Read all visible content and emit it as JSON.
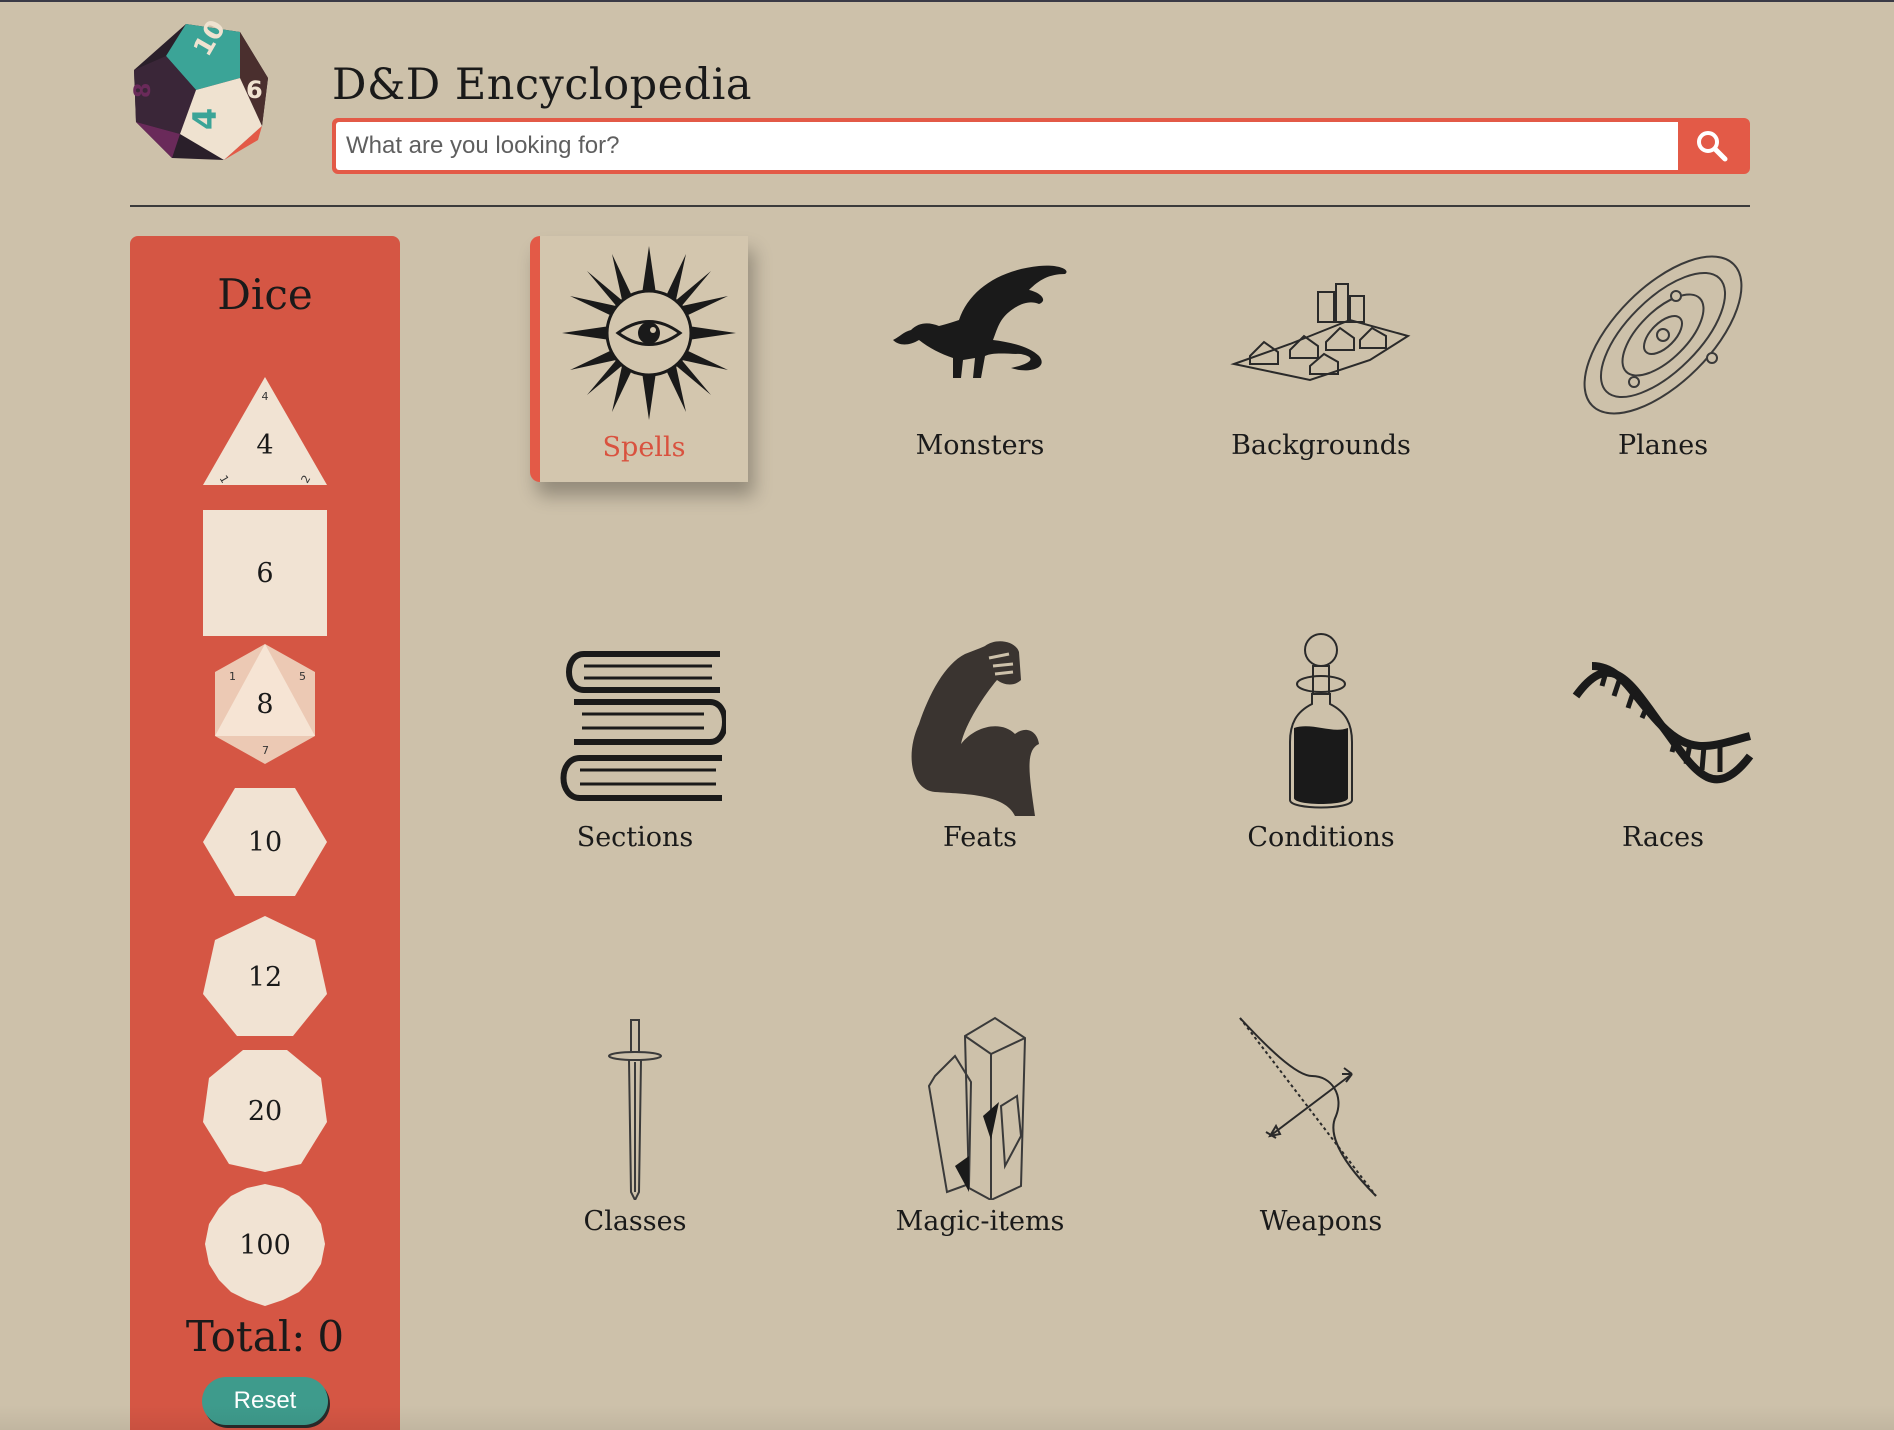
{
  "header": {
    "title": "D&D Encyclopedia",
    "search_placeholder": "What are you looking for?",
    "logo_die_numbers": [
      "10",
      "6",
      "8",
      "4"
    ]
  },
  "dice": {
    "title": "Dice",
    "items": [
      {
        "label": "4",
        "shape": "triangle",
        "corner_numbers": [
          "4",
          "1",
          "2"
        ]
      },
      {
        "label": "6",
        "shape": "square"
      },
      {
        "label": "8",
        "shape": "hexagon",
        "corner_numbers": [
          "1",
          "5",
          "7"
        ]
      },
      {
        "label": "10",
        "shape": "hexagon"
      },
      {
        "label": "12",
        "shape": "heptagon"
      },
      {
        "label": "20",
        "shape": "octagon"
      },
      {
        "label": "100",
        "shape": "circle-star"
      }
    ],
    "total_label": "Total:",
    "total_value": "0",
    "reset_label": "Reset"
  },
  "categories": [
    {
      "label": "Spells",
      "icon": "sun-eye-icon",
      "selected": true
    },
    {
      "label": "Monsters",
      "icon": "dragon-icon"
    },
    {
      "label": "Backgrounds",
      "icon": "village-icon"
    },
    {
      "label": "Planes",
      "icon": "orbit-icon"
    },
    {
      "label": "Sections",
      "icon": "book-stack-icon"
    },
    {
      "label": "Feats",
      "icon": "flexed-arm-icon"
    },
    {
      "label": "Conditions",
      "icon": "potion-bottle-icon"
    },
    {
      "label": "Races",
      "icon": "dna-icon"
    },
    {
      "label": "Classes",
      "icon": "sword-icon"
    },
    {
      "label": "Magic-items",
      "icon": "crystal-icon"
    },
    {
      "label": "Weapons",
      "icon": "bow-arrow-icon"
    }
  ],
  "colors": {
    "background": "#cdc1aa",
    "accent": "#e35a47",
    "panel": "#d55644",
    "die_face": "#f1e3d3",
    "reset": "#3e9b8c"
  }
}
